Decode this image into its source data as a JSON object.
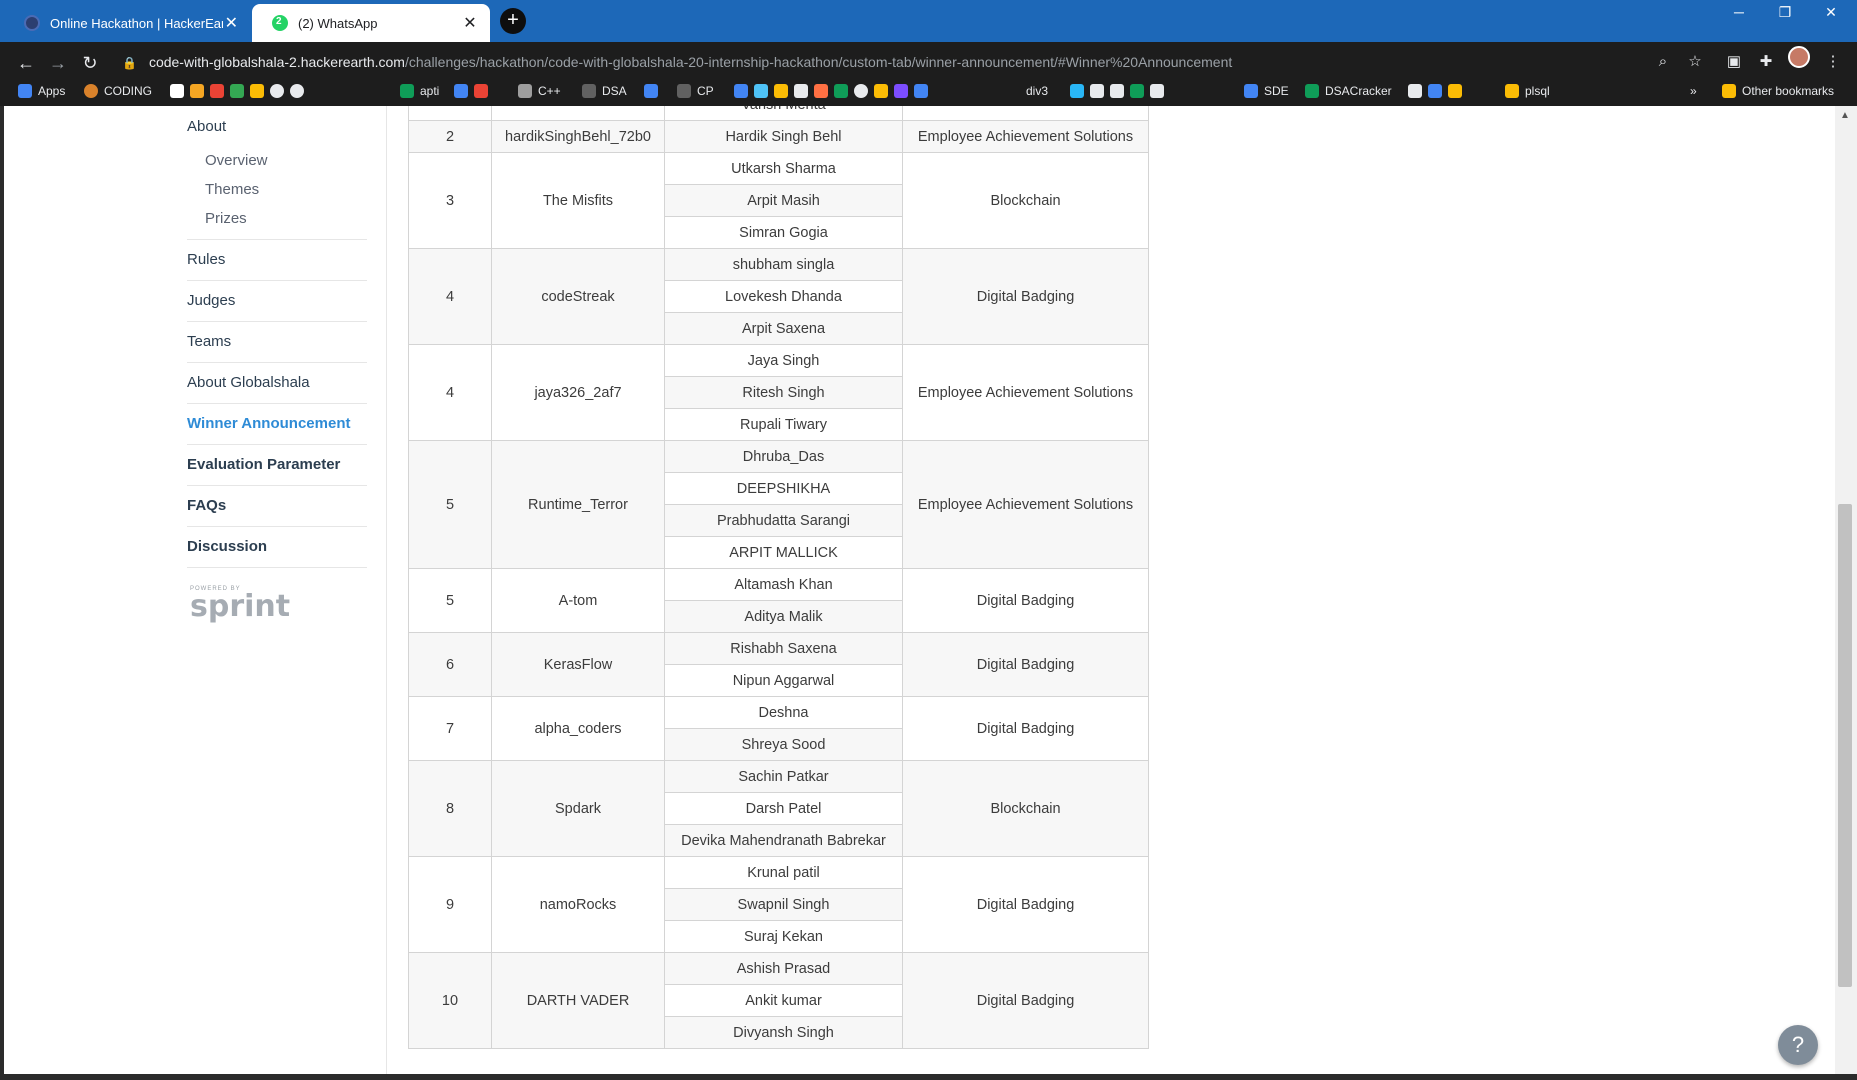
{
  "browser": {
    "tabs": [
      {
        "title": "Online Hackathon | HackerEarth C"
      },
      {
        "title": "(2) WhatsApp"
      }
    ],
    "url_host": "code-with-globalshala-2.hackerearth.com",
    "url_path": "/challenges/hackathon/code-with-globalshala-20-internship-hackathon/custom-tab/winner-announcement/#Winner%20Announcement",
    "bookmarks": [
      "Apps",
      "CODING",
      "apti",
      "C++",
      "DSA",
      "CP",
      "div3",
      "SDE",
      "DSACracker",
      "plsql",
      "Other bookmarks"
    ]
  },
  "sidebar": {
    "about": "About",
    "sub": [
      "Overview",
      "Themes",
      "Prizes"
    ],
    "items": [
      "Rules",
      "Judges",
      "Teams",
      "About Globalshala",
      "Winner Announcement",
      "Evaluation Parameter",
      "FAQs",
      "Discussion"
    ],
    "powered_by": "POWERED BY",
    "brand": "sprint"
  },
  "table": {
    "rows": [
      {
        "rank": "",
        "team": "",
        "members": [
          "Vansh Mehta"
        ],
        "domain": "",
        "partial": true
      },
      {
        "rank": "2",
        "team": "hardikSinghBehl_72b0",
        "members": [
          "Hardik Singh Behl"
        ],
        "domain": "Employee Achievement Solutions"
      },
      {
        "rank": "3",
        "team": "The Misfits",
        "members": [
          "Utkarsh Sharma",
          "Arpit Masih",
          "Simran Gogia"
        ],
        "domain": "Blockchain"
      },
      {
        "rank": "4",
        "team": "codeStreak",
        "members": [
          "shubham singla",
          "Lovekesh Dhanda",
          "Arpit Saxena"
        ],
        "domain": "Digital Badging"
      },
      {
        "rank": "4",
        "team": "jaya326_2af7",
        "members": [
          "Jaya Singh",
          "Ritesh Singh",
          "Rupali Tiwary"
        ],
        "domain": "Employee Achievement Solutions"
      },
      {
        "rank": "5",
        "team": "Runtime_Terror",
        "members": [
          "Dhruba_Das",
          "DEEPSHIKHA",
          "Prabhudatta Sarangi",
          "ARPIT MALLICK"
        ],
        "domain": "Employee Achievement Solutions"
      },
      {
        "rank": "5",
        "team": "A-tom",
        "members": [
          "Altamash Khan",
          "Aditya Malik"
        ],
        "domain": "Digital Badging"
      },
      {
        "rank": "6",
        "team": "KerasFlow",
        "members": [
          "Rishabh Saxena",
          "Nipun Aggarwal"
        ],
        "domain": "Digital Badging"
      },
      {
        "rank": "7",
        "team": "alpha_coders",
        "members": [
          "Deshna",
          "Shreya Sood"
        ],
        "domain": "Digital Badging"
      },
      {
        "rank": "8",
        "team": "Spdark",
        "members": [
          "Sachin Patkar",
          "Darsh Patel",
          "Devika Mahendranath Babrekar"
        ],
        "domain": "Blockchain"
      },
      {
        "rank": "9",
        "team": "namoRocks",
        "members": [
          "Krunal patil",
          "Swapnil Singh",
          "Suraj Kekan"
        ],
        "domain": "Digital Badging"
      },
      {
        "rank": "10",
        "team": "DARTH VADER",
        "members": [
          "Ashish Prasad",
          "Ankit kumar",
          "Divyansh Singh"
        ],
        "domain": "Digital Badging"
      }
    ]
  },
  "help_label": "?"
}
